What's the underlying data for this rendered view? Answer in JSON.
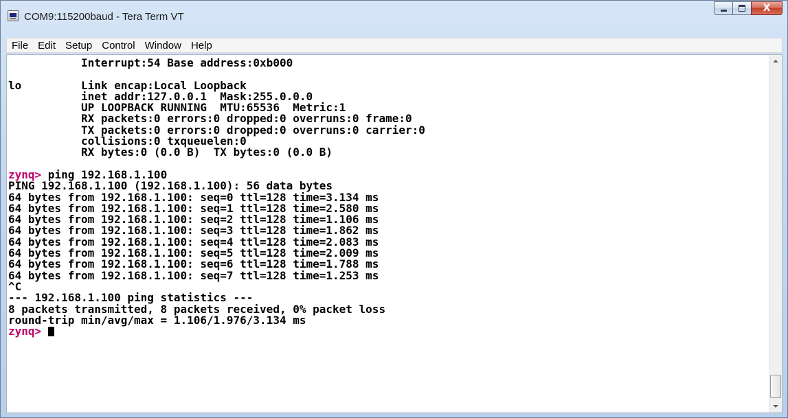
{
  "window": {
    "title": "COM9:115200baud - Tera Term VT",
    "icon": "tera-term-app-icon",
    "caption_buttons": {
      "minimize": "minimize-icon",
      "maximize": "maximize-icon",
      "close": "close-icon",
      "close_glyph": "X"
    }
  },
  "menu": {
    "items": [
      {
        "label": "File"
      },
      {
        "label": "Edit"
      },
      {
        "label": "Setup"
      },
      {
        "label": "Control"
      },
      {
        "label": "Window"
      },
      {
        "label": "Help"
      }
    ]
  },
  "terminal": {
    "prompt_color": "#c0006a",
    "lines": [
      {
        "text": "           Interrupt:54 Base address:0xb000"
      },
      {
        "text": ""
      },
      {
        "text": "lo         Link encap:Local Loopback"
      },
      {
        "text": "           inet addr:127.0.0.1  Mask:255.0.0.0"
      },
      {
        "text": "           UP LOOPBACK RUNNING  MTU:65536  Metric:1"
      },
      {
        "text": "           RX packets:0 errors:0 dropped:0 overruns:0 frame:0"
      },
      {
        "text": "           TX packets:0 errors:0 dropped:0 overruns:0 carrier:0"
      },
      {
        "text": "           collisions:0 txqueuelen:0"
      },
      {
        "text": "           RX bytes:0 (0.0 B)  TX bytes:0 (0.0 B)"
      },
      {
        "text": ""
      },
      {
        "prompt": "zynq>",
        "text": " ping 192.168.1.100"
      },
      {
        "text": "PING 192.168.1.100 (192.168.1.100): 56 data bytes"
      },
      {
        "text": "64 bytes from 192.168.1.100: seq=0 ttl=128 time=3.134 ms"
      },
      {
        "text": "64 bytes from 192.168.1.100: seq=1 ttl=128 time=2.580 ms"
      },
      {
        "text": "64 bytes from 192.168.1.100: seq=2 ttl=128 time=1.106 ms"
      },
      {
        "text": "64 bytes from 192.168.1.100: seq=3 ttl=128 time=1.862 ms"
      },
      {
        "text": "64 bytes from 192.168.1.100: seq=4 ttl=128 time=2.083 ms"
      },
      {
        "text": "64 bytes from 192.168.1.100: seq=5 ttl=128 time=2.009 ms"
      },
      {
        "text": "64 bytes from 192.168.1.100: seq=6 ttl=128 time=1.788 ms"
      },
      {
        "text": "64 bytes from 192.168.1.100: seq=7 ttl=128 time=1.253 ms"
      },
      {
        "text": "^C"
      },
      {
        "text": "--- 192.168.1.100 ping statistics ---"
      },
      {
        "text": "8 packets transmitted, 8 packets received, 0% packet loss"
      },
      {
        "text": "round-trip min/avg/max = 1.106/1.976/3.134 ms"
      },
      {
        "prompt": "zynq>",
        "text": " ",
        "cursor": true
      }
    ]
  },
  "scrollbar": {
    "up_icon": "scroll-up-arrow-icon",
    "down_icon": "scroll-down-arrow-icon"
  }
}
